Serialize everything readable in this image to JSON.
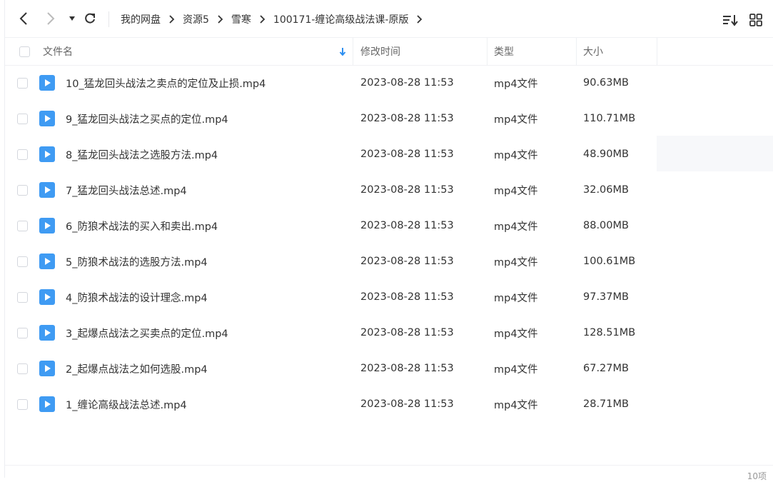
{
  "breadcrumb": [
    "我的网盘",
    "资源5",
    "雪寒",
    "100171-缠论高级战法课-原版"
  ],
  "columns": {
    "name": "文件名",
    "modified": "修改时间",
    "type": "类型",
    "size": "大小"
  },
  "files": [
    {
      "name": "10_猛龙回头战法之卖点的定位及止损.mp4",
      "modified": "2023-08-28 11:53",
      "type": "mp4文件",
      "size": "90.63MB"
    },
    {
      "name": "9_猛龙回头战法之买点的定位.mp4",
      "modified": "2023-08-28 11:53",
      "type": "mp4文件",
      "size": "110.71MB"
    },
    {
      "name": "8_猛龙回头战法之选股方法.mp4",
      "modified": "2023-08-28 11:53",
      "type": "mp4文件",
      "size": "48.90MB"
    },
    {
      "name": "7_猛龙回头战法总述.mp4",
      "modified": "2023-08-28 11:53",
      "type": "mp4文件",
      "size": "32.06MB"
    },
    {
      "name": "6_防狼术战法的买入和卖出.mp4",
      "modified": "2023-08-28 11:53",
      "type": "mp4文件",
      "size": "88.00MB"
    },
    {
      "name": "5_防狼术战法的选股方法.mp4",
      "modified": "2023-08-28 11:53",
      "type": "mp4文件",
      "size": "100.61MB"
    },
    {
      "name": "4_防狼术战法的设计理念.mp4",
      "modified": "2023-08-28 11:53",
      "type": "mp4文件",
      "size": "97.37MB"
    },
    {
      "name": "3_起爆点战法之买卖点的定位.mp4",
      "modified": "2023-08-28 11:53",
      "type": "mp4文件",
      "size": "128.51MB"
    },
    {
      "name": "2_起爆点战法之如何选股.mp4",
      "modified": "2023-08-28 11:53",
      "type": "mp4文件",
      "size": "67.27MB"
    },
    {
      "name": "1_缠论高级战法总述.mp4",
      "modified": "2023-08-28 11:53",
      "type": "mp4文件",
      "size": "28.71MB"
    }
  ],
  "footer": {
    "count": "10项"
  },
  "icons": {
    "back": "chevron-left-icon",
    "forward": "chevron-right-icon",
    "history": "caret-down-icon",
    "refresh": "refresh-icon",
    "sort": "sort-icon",
    "view": "grid-view-icon",
    "file": "video-file-icon",
    "sort_indicator": "arrow-down-icon"
  },
  "colors": {
    "accent": "#2e8ff0",
    "file_icon": "#3f9bf3"
  }
}
